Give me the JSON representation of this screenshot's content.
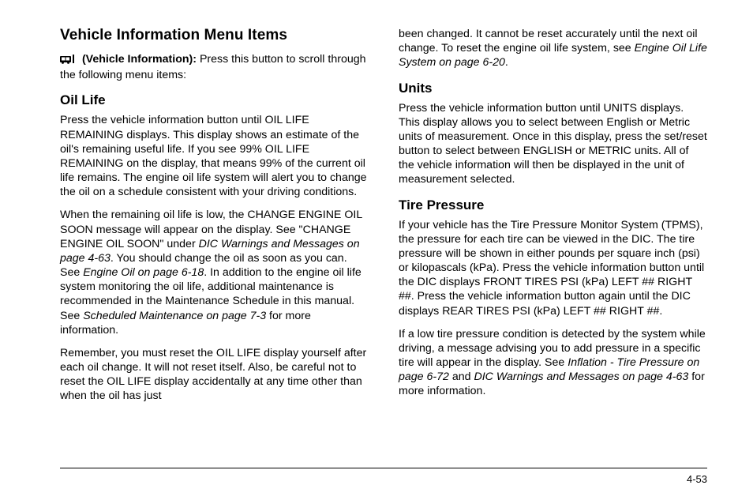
{
  "left": {
    "heading": "Vehicle Information Menu Items",
    "lead_label": "(Vehicle Information):",
    "lead_text": "Press this button to scroll through the following menu items:",
    "oil_life_heading": "Oil Life",
    "oil_life_p1": "Press the vehicle information button until OIL LIFE REMAINING displays. This display shows an estimate of the oil's remaining useful life. If you see 99% OIL LIFE REMAINING on the display, that means 99% of the current oil life remains. The engine oil life system will alert you to change the oil on a schedule consistent with your driving conditions.",
    "oil_life_p2a": "When the remaining oil life is low, the CHANGE ENGINE OIL SOON message will appear on the display. See \"CHANGE ENGINE OIL SOON\" under ",
    "oil_life_p2_ref1": "DIC Warnings and Messages on page 4-63",
    "oil_life_p2b": ". You should change the oil as soon as you can. See ",
    "oil_life_p2_ref2": "Engine Oil on page 6-18",
    "oil_life_p2c": ". In addition to the engine oil life system monitoring the oil life, additional maintenance is recommended in the Maintenance Schedule in this manual. See ",
    "oil_life_p2_ref3": "Scheduled Maintenance on page 7-3",
    "oil_life_p2d": " for more information.",
    "oil_life_p3": "Remember, you must reset the OIL LIFE display yourself after each oil change. It will not reset itself. Also, be careful not to reset the OIL LIFE display accidentally at any time other than when the oil has just"
  },
  "right": {
    "cont_a": "been changed. It cannot be reset accurately until the next oil change. To reset the engine oil life system, see ",
    "cont_ref": "Engine Oil Life System on page 6-20",
    "cont_b": ".",
    "units_heading": "Units",
    "units_p": "Press the vehicle information button until UNITS displays. This display allows you to select between English or Metric units of measurement. Once in this display, press the set/reset button to select between ENGLISH or METRIC units. All of the vehicle information will then be displayed in the unit of measurement selected.",
    "tire_heading": "Tire Pressure",
    "tire_p1": "If your vehicle has the Tire Pressure Monitor System (TPMS), the pressure for each tire can be viewed in the DIC. The tire pressure will be shown in either pounds per square inch (psi) or kilopascals (kPa). Press the vehicle information button until the DIC displays FRONT TIRES PSI (kPa) LEFT ## RIGHT ##. Press the vehicle information button again until the DIC displays REAR TIRES PSI (kPa) LEFT ## RIGHT ##.",
    "tire_p2a": "If a low tire pressure condition is detected by the system while driving, a message advising you to add pressure in a specific tire will appear in the display. See ",
    "tire_p2_ref1": "Inflation - Tire Pressure on page 6-72",
    "tire_p2b": " and ",
    "tire_p2_ref2": "DIC Warnings and Messages on page 4-63",
    "tire_p2c": " for more information."
  },
  "page_number": "4-53"
}
